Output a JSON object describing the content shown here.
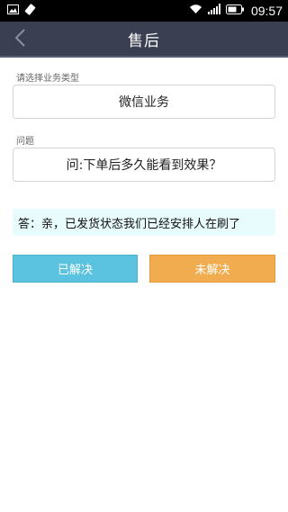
{
  "status_bar": {
    "time": "09:57",
    "left_icons": [
      "image-icon",
      "usb-debug-icon"
    ],
    "right_icons": [
      "wifi-icon",
      "signal-icon",
      "battery-icon"
    ]
  },
  "header": {
    "title": "售后",
    "back_icon": "chevron-left-icon"
  },
  "form": {
    "business_type_label": "请选择业务类型",
    "business_type_value": "微信业务",
    "question_label": "问题",
    "question_value": "问:下单后多久能看到效果？"
  },
  "answer": {
    "text": "答：亲，已发货状态我们已经安排人在刷了"
  },
  "actions": {
    "solved_label": "已解决",
    "unsolved_label": "未解决"
  },
  "colors": {
    "header_bg": "#3a3f52",
    "solved_button": "#5bc3df",
    "unsolved_button": "#f0ac4e",
    "answer_bg": "#e8fbfd"
  }
}
